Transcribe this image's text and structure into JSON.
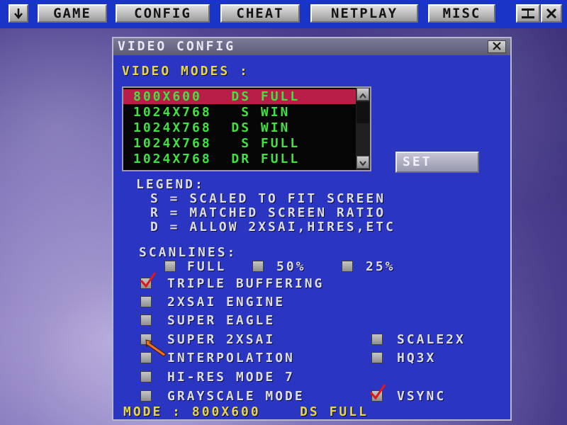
{
  "menubar": {
    "down_icon": "down-arrow-icon",
    "items": [
      "GAME",
      "CONFIG",
      "CHEAT",
      "NETPLAY",
      "MISC"
    ],
    "minimize_icon": "minimize-icon",
    "close_icon": "close-icon"
  },
  "dialog": {
    "title": "VIDEO CONFIG",
    "close_icon": "close-icon",
    "modes_label": "VIDEO MODES :",
    "modes": [
      "800X600   DS FULL",
      "1024X768   S WIN",
      "1024X768  DS WIN",
      "1024X768   S FULL",
      "1024X768  DR FULL"
    ],
    "selected_mode_index": 0,
    "set_label": "SET",
    "legend": {
      "title": "LEGEND:",
      "lines": [
        "S = SCALED TO FIT SCREEN",
        "R = MATCHED SCREEN RATIO",
        "D = ALLOW 2XSAI,HIRES,ETC"
      ]
    },
    "scanlines": {
      "label": "SCANLINES:",
      "options": [
        "FULL",
        "50%",
        "25%"
      ]
    },
    "options_left": [
      {
        "label": "TRIPLE BUFFERING",
        "checked": true
      },
      {
        "label": "2XSAI ENGINE",
        "checked": false
      },
      {
        "label": "SUPER EAGLE",
        "checked": false
      },
      {
        "label": "SUPER 2XSAI",
        "checked": false
      },
      {
        "label": "INTERPOLATION",
        "checked": false
      },
      {
        "label": "HI-RES MODE 7",
        "checked": false
      },
      {
        "label": "GRAYSCALE MODE",
        "checked": false
      }
    ],
    "options_right": [
      {
        "label": "SCALE2X",
        "checked": false
      },
      {
        "label": "HQ3X",
        "checked": false
      },
      {
        "label": "VSYNC",
        "checked": true
      }
    ],
    "footer": "MODE : 800X600    DS FULL"
  },
  "colors": {
    "menubar": "#1b34c8",
    "dialog_bg": "#2a36c2",
    "label_yellow": "#e8d640",
    "list_green": "#3fe23f",
    "list_selected": "#b81e48"
  }
}
